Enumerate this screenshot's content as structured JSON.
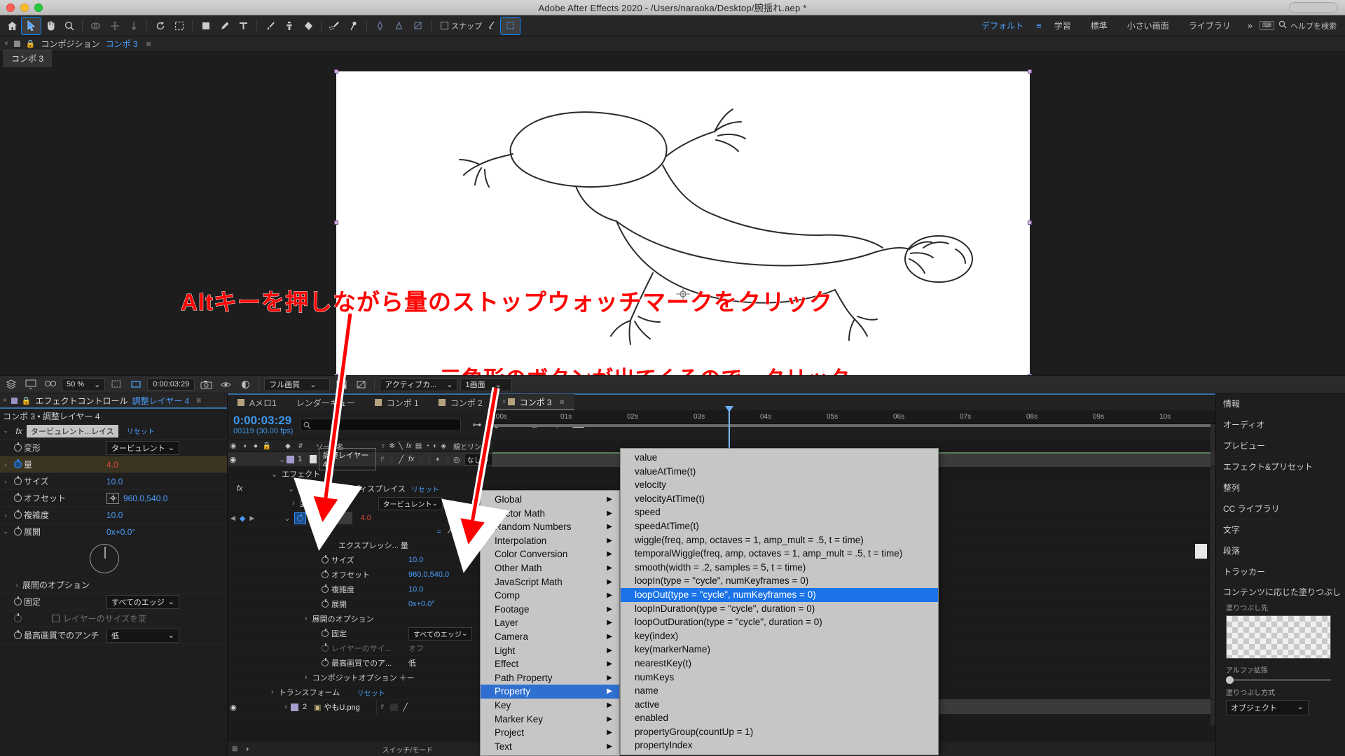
{
  "window": {
    "title": "Adobe After Effects 2020 - /Users/naraoka/Desktop/腕揺れ.aep *"
  },
  "toolbar": {
    "snap_label": "スナップ",
    "workspaces": [
      {
        "label": "デフォルト",
        "active": true
      },
      {
        "label": "学習",
        "active": false
      },
      {
        "label": "標準",
        "active": false
      },
      {
        "label": "小さい画面",
        "active": false
      },
      {
        "label": "ライブラリ",
        "active": false
      }
    ],
    "overflow": "»",
    "search_placeholder": "ヘルプを検索"
  },
  "comp_header": {
    "panel_label": "コンポジション",
    "comp_name": "コンポ 3",
    "tab_label": "コンポ 3"
  },
  "viewer_bar": {
    "zoom": "50 %",
    "time": "0:00:03:29",
    "quality": "フル画質",
    "view_mode": "アクティブカ...",
    "views": "1画面"
  },
  "effect_controls": {
    "tab_title": "エフェクトコントロール",
    "tab_layer": "調整レイヤー 4",
    "breadcrumb": "コンポ 3 • 調整レイヤー 4",
    "effect_name": "タービュレント...レイス",
    "reset_label": "リセット",
    "rows": [
      {
        "name": "変形",
        "value": "タービュレント",
        "type": "dropdown",
        "stopwatch": false
      },
      {
        "name": "量",
        "value": "4.0",
        "type": "number-red",
        "stopwatch": true,
        "expandable": true,
        "highlight": true
      },
      {
        "name": "サイズ",
        "value": "10.0",
        "type": "number",
        "stopwatch": false,
        "expandable": true
      },
      {
        "name": "オフセット",
        "value": "960.0,540.0",
        "type": "point",
        "stopwatch": false
      },
      {
        "name": "複雑度",
        "value": "10.0",
        "type": "number",
        "stopwatch": false,
        "expandable": true
      },
      {
        "name": "展開",
        "value": "0x+0.0°",
        "type": "angle",
        "stopwatch": false,
        "expandable": true
      }
    ],
    "group_label": "展開のオプション",
    "group_rows": [
      {
        "name": "固定",
        "value": "すべてのエッジ",
        "type": "dropdown"
      },
      {
        "name": "",
        "value": "レイヤーのサイズを変",
        "type": "checkbox",
        "checked": false,
        "dim": true
      },
      {
        "name": "最高画質でのアンチ",
        "value": "低",
        "type": "dropdown"
      }
    ]
  },
  "timeline": {
    "tabs": [
      {
        "label": "Aメロ1",
        "active": false
      },
      {
        "label": "レンダーキュー",
        "active": false
      },
      {
        "label": "コンポ 1",
        "active": false
      },
      {
        "label": "コンポ 2",
        "active": false
      },
      {
        "label": "コンポ 3",
        "active": true
      }
    ],
    "current_time": "0:00:03:29",
    "frames": "00119 (30.00 fps)",
    "search_placeholder": "",
    "columns": {
      "source_name": "ソース名",
      "parent_link": "親とリンク"
    },
    "ruler_ticks": [
      ":00s",
      "01s",
      "02s",
      "03s",
      "04s",
      "05s",
      "06s",
      "07s",
      "08s",
      "09s",
      "10s"
    ],
    "rows": [
      {
        "indent": 0,
        "index": "1",
        "label": "調整レイヤー 4",
        "type": "layer",
        "parent": "なし",
        "eye": true
      },
      {
        "indent": 1,
        "label": "エフェクト",
        "type": "group"
      },
      {
        "indent": 2,
        "label": "タービュレントディスプレイス",
        "type": "effect",
        "value": "リセット"
      },
      {
        "indent": 3,
        "label": "変形",
        "type": "prop",
        "value": "タービュレント"
      },
      {
        "indent": 3,
        "label": "量",
        "type": "prop-keyed",
        "value": "4.0",
        "stopwatch": true
      },
      {
        "indent": 4,
        "label": "エクスプレッシ... 量",
        "type": "expression"
      },
      {
        "indent": 3,
        "label": "サイズ",
        "type": "prop",
        "value": "10.0"
      },
      {
        "indent": 3,
        "label": "オフセット",
        "type": "prop",
        "value": "960.0,540.0"
      },
      {
        "indent": 3,
        "label": "複雑度",
        "type": "prop",
        "value": "10.0"
      },
      {
        "indent": 3,
        "label": "展開",
        "type": "prop",
        "value": "0x+0.0°"
      },
      {
        "indent": 3,
        "label": "展開のオプション",
        "type": "group"
      },
      {
        "indent": 4,
        "label": "固定",
        "type": "prop",
        "value": "すべてのエッジ"
      },
      {
        "indent": 4,
        "label": "レイヤーのサイ...",
        "type": "prop",
        "value": "オフ"
      },
      {
        "indent": 4,
        "label": "最高画質でのア...",
        "type": "prop",
        "value": "低"
      },
      {
        "indent": 3,
        "label": "コンポジットオプション",
        "type": "group",
        "value": "＋ー"
      },
      {
        "indent": 1,
        "label": "トランスフォーム",
        "type": "group",
        "value": "リセット"
      },
      {
        "indent": 0,
        "index": "2",
        "label": "やもU.png",
        "type": "layer",
        "eye": true
      }
    ],
    "bottom_label": "スイッチ/モード"
  },
  "context_menu": {
    "categories": [
      {
        "label": "Global",
        "submenu": true
      },
      {
        "label": "Vector Math",
        "submenu": true
      },
      {
        "label": "Random Numbers",
        "submenu": true
      },
      {
        "label": "Interpolation",
        "submenu": true
      },
      {
        "label": "Color Conversion",
        "submenu": true
      },
      {
        "label": "Other Math",
        "submenu": true
      },
      {
        "label": "JavaScript Math",
        "submenu": true
      },
      {
        "label": "Comp",
        "submenu": true
      },
      {
        "label": "Footage",
        "submenu": true
      },
      {
        "label": "Layer",
        "submenu": true
      },
      {
        "label": "Camera",
        "submenu": true
      },
      {
        "label": "Light",
        "submenu": true
      },
      {
        "label": "Effect",
        "submenu": true
      },
      {
        "label": "Path Property",
        "submenu": true
      },
      {
        "label": "Property",
        "submenu": true,
        "active": true
      },
      {
        "label": "Key",
        "submenu": true
      },
      {
        "label": "Marker Key",
        "submenu": true
      },
      {
        "label": "Project",
        "submenu": true
      },
      {
        "label": "Text",
        "submenu": true
      }
    ],
    "items": [
      {
        "label": "value"
      },
      {
        "label": "valueAtTime(t)"
      },
      {
        "label": "velocity"
      },
      {
        "label": "velocityAtTime(t)"
      },
      {
        "label": "speed"
      },
      {
        "label": "speedAtTime(t)"
      },
      {
        "label": "wiggle(freq, amp, octaves = 1, amp_mult = .5, t = time)"
      },
      {
        "label": "temporalWiggle(freq, amp, octaves = 1, amp_mult = .5, t = time)"
      },
      {
        "label": "smooth(width = .2, samples = 5, t = time)"
      },
      {
        "label": "loopIn(type = \"cycle\", numKeyframes = 0)"
      },
      {
        "label": "loopOut(type = \"cycle\", numKeyframes = 0)",
        "highlighted": true
      },
      {
        "label": "loopInDuration(type = \"cycle\", duration = 0)"
      },
      {
        "label": "loopOutDuration(type = \"cycle\", duration = 0)"
      },
      {
        "label": "key(index)"
      },
      {
        "label": "key(markerName)"
      },
      {
        "label": "nearestKey(t)"
      },
      {
        "label": "numKeys"
      },
      {
        "label": "name"
      },
      {
        "label": "active"
      },
      {
        "label": "enabled"
      },
      {
        "label": "propertyGroup(countUp = 1)"
      },
      {
        "label": "propertyIndex"
      }
    ]
  },
  "right_dock": {
    "items": [
      {
        "label": "情報"
      },
      {
        "label": "オーディオ"
      },
      {
        "label": "プレビュー"
      },
      {
        "label": "エフェクト&プリセット"
      },
      {
        "label": "整列"
      },
      {
        "label": "CC ライブラリ"
      },
      {
        "label": "文字"
      },
      {
        "label": "段落"
      },
      {
        "label": "トラッカー"
      },
      {
        "label": "コンテンツに応じた塗りつぶし"
      }
    ],
    "fill_target_label": "塗りつぶし先",
    "alpha_label": "アルファ拡張",
    "fill_method_label": "塗りつぶし方式",
    "fill_method_value": "オブジェクト"
  },
  "annotations": {
    "line1": "Altキーを押しながら量のストップウォッチマークをクリック",
    "line2": "三角形のボタンが出てくるので、クリック",
    "color": "#ff0000"
  },
  "colors": {
    "accent_blue": "#4a9eff",
    "highlight_blue": "#1a73e8",
    "annotation_red": "#ff0000",
    "menu_bg": "#c6c6c6",
    "panel_bg": "#1e1e1e"
  }
}
